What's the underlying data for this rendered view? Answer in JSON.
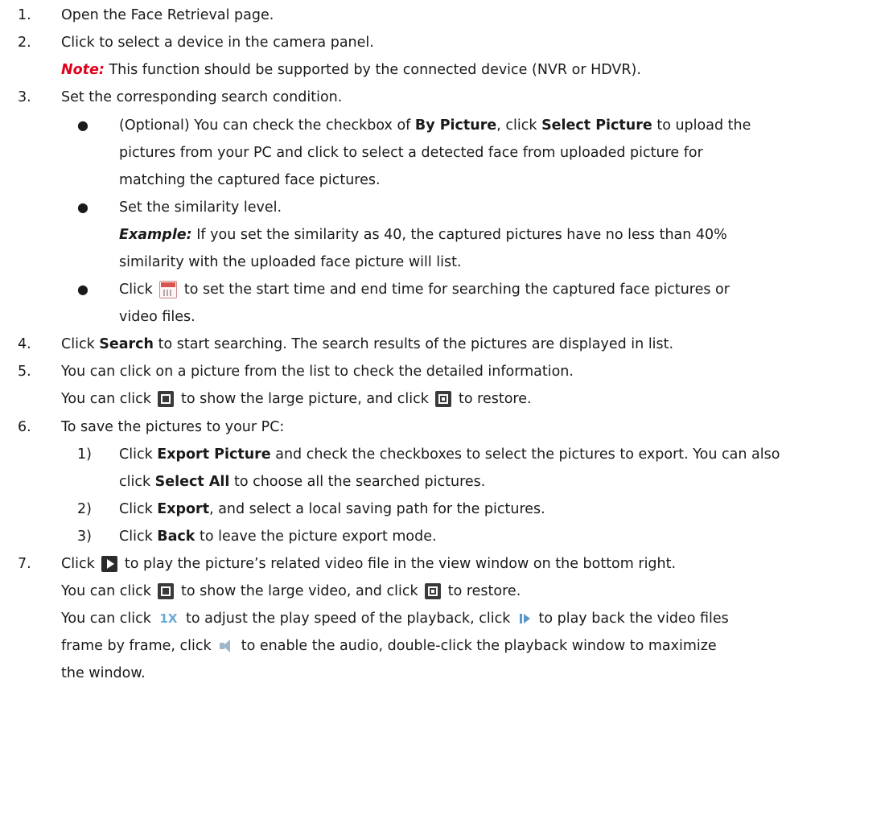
{
  "steps": {
    "s1": {
      "num": "1.",
      "text": "Open the Face Retrieval page."
    },
    "s2": {
      "num": "2.",
      "text": "Click to select a device in the camera panel.",
      "note_label": "Note:",
      "note_text": " This function should be supported by the connected device (NVR or HDVR)."
    },
    "s3": {
      "num": "3.",
      "text": "Set the corresponding search condition.",
      "b1": {
        "l1_a": "(Optional) You can check the checkbox of ",
        "l1_b": "By Picture",
        "l1_c": ", click ",
        "l1_d": "Select Picture",
        "l1_e": " to upload the",
        "l2": "pictures from your PC and click to select a detected face from uploaded picture for",
        "l3": "matching the captured face pictures."
      },
      "b2": {
        "l1": "Set the similarity level.",
        "example_label": "Example:",
        "l2": " If you set the similarity as 40, the captured pictures have no less than 40%",
        "l3": "similarity with the uploaded face picture will list."
      },
      "b3": {
        "l1_a": "Click ",
        "l1_b": " to set the start time and end time for searching the captured face pictures or",
        "l2": "video files."
      }
    },
    "s4": {
      "num": "4.",
      "a": "Click ",
      "b": "Search",
      "c": " to start searching. The search results of the pictures are displayed in list."
    },
    "s5": {
      "num": "5.",
      "l1": "You can click on a picture from the list to check the detailed information.",
      "l2_a": "You can click ",
      "l2_b": " to show the large picture, and click ",
      "l2_c": " to restore."
    },
    "s6": {
      "num": "6.",
      "text": "To save the pictures to your PC:",
      "sub1": {
        "num": "1)",
        "a": "Click ",
        "b": "Export Picture",
        "c": " and check the checkboxes to select the pictures to export. You can also",
        "l2_a": "click ",
        "l2_b": "Select All",
        "l2_c": " to choose all the searched pictures."
      },
      "sub2": {
        "num": "2)",
        "a": "Click ",
        "b": "Export",
        "c": ", and select a local saving path for the pictures."
      },
      "sub3": {
        "num": "3)",
        "a": "Click ",
        "b": "Back",
        "c": " to leave the picture export mode."
      }
    },
    "s7": {
      "num": "7.",
      "l1_a": "Click ",
      "l1_b": " to play the picture’s related video file in the view window on the bottom right.",
      "l2_a": "You can click ",
      "l2_b": " to show the large video, and click ",
      "l2_c": " to restore.",
      "l3_a": "You can click ",
      "l3_b": " to adjust the play speed of the playback, click ",
      "l3_c": " to play back the video files",
      "l4_a": "frame by frame, click ",
      "l4_b": " to enable the audio, double-click the playback window to maximize",
      "l5": "the window.",
      "speed_icon_text": "1X"
    }
  },
  "icons": {
    "bullet": "●",
    "calendar": "calendar-icon",
    "maximize": "maximize-icon",
    "restore": "restore-icon",
    "play": "play-icon",
    "speed": "speed-icon",
    "frame": "frame-forward-icon",
    "audio": "audio-icon"
  }
}
